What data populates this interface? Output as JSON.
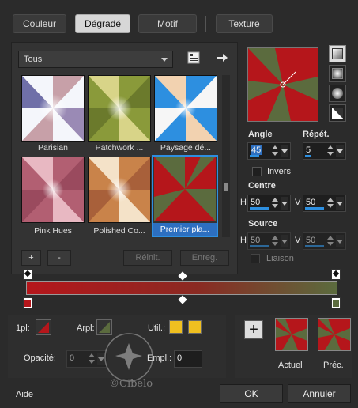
{
  "tabs": [
    {
      "label": "Couleur"
    },
    {
      "label": "Dégradé"
    },
    {
      "label": "Motif"
    },
    {
      "label": "Texture"
    }
  ],
  "library": {
    "dropdown_value": "Tous",
    "thumbnails": [
      {
        "label": "Parisian"
      },
      {
        "label": "Patchwork ..."
      },
      {
        "label": "Paysage dé..."
      },
      {
        "label": "Pink Hues"
      },
      {
        "label": "Polished Co..."
      },
      {
        "label": "Premier pla..."
      }
    ]
  },
  "list_buttons": {
    "add": "+",
    "remove": "-",
    "reinit": "Réinit.",
    "save": "Enreg."
  },
  "settings": {
    "angle_label": "Angle",
    "angle_value": "45",
    "repeat_label": "Répét.",
    "repeat_value": "5",
    "invert_label": "Invers",
    "center_label": "Centre",
    "center_h_label": "H",
    "center_h_value": "50",
    "center_v_label": "V",
    "center_v_value": "50",
    "source_label": "Source",
    "source_h_label": "H",
    "source_h_value": "50",
    "source_v_label": "V",
    "source_v_value": "50",
    "link_label": "Liaison"
  },
  "colors": {
    "gradient_left": "#b5161b",
    "gradient_right": "#5b6b3e",
    "fg_swatch": "#f0c020",
    "bg_swatch": "#f0c020",
    "accent": "#2d8fe0"
  },
  "markers": {
    "fg_label": "1pl:",
    "bg_label": "Arpl:",
    "user_label": "Util.:",
    "opacity_label": "Opacité:",
    "opacity_value": "0",
    "location_label": "Empl.:",
    "location_value": "0"
  },
  "preview": {
    "current_label": "Actuel",
    "previous_label": "Préc."
  },
  "footer": {
    "help": "Aide",
    "ok": "OK",
    "cancel": "Annuler"
  },
  "watermark": {
    "text": "©Cibelo"
  }
}
